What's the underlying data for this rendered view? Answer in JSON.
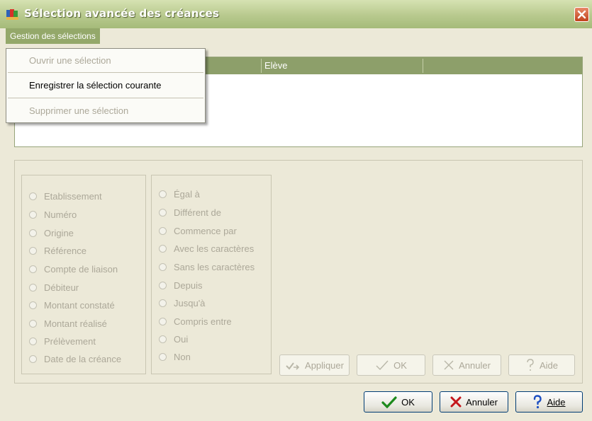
{
  "window": {
    "title": "Sélection avancée des créances"
  },
  "menubar": {
    "gestion_label": "Gestion des sélections"
  },
  "menu": {
    "items": [
      {
        "label": "Ouvrir une sélection",
        "enabled": false
      },
      {
        "label": "Enregistrer la sélection courante",
        "enabled": true
      },
      {
        "label": "Supprimer une sélection",
        "enabled": false
      }
    ]
  },
  "list": {
    "columns": [
      "",
      "Elève",
      ""
    ]
  },
  "fields": {
    "options": [
      "Etablissement",
      "Numéro",
      "Origine",
      "Référence",
      "Compte de liaison",
      "Débiteur",
      "Montant constaté",
      "Montant réalisé",
      "Prélèvement",
      "Date de la créance"
    ]
  },
  "operators": {
    "options": [
      "Égal à",
      "Différent de",
      "Commence par",
      "Avec les caractères",
      "Sans les caractères",
      "Depuis",
      "Jusqu'à",
      "Compris entre",
      "Oui",
      "Non"
    ]
  },
  "inner_buttons": {
    "apply": "Appliquer",
    "ok": "OK",
    "cancel": "Annuler",
    "help": "Aide"
  },
  "footer_buttons": {
    "ok": "OK",
    "cancel": "Annuler",
    "help": "Aide"
  },
  "icons": {
    "app": "folder-books-icon",
    "close": "close-x-icon",
    "apply": "apply-arrow-icon",
    "ok": "check-icon",
    "cancel": "red-x-icon",
    "help": "question-mark-icon"
  },
  "colors": {
    "title_bar": "#a6bb7a",
    "header": "#8d9f6a",
    "close": "#c1411b",
    "ok_check": "#1d8a1d",
    "cancel_x": "#c4161c",
    "help_q": "#1d4fc2"
  }
}
